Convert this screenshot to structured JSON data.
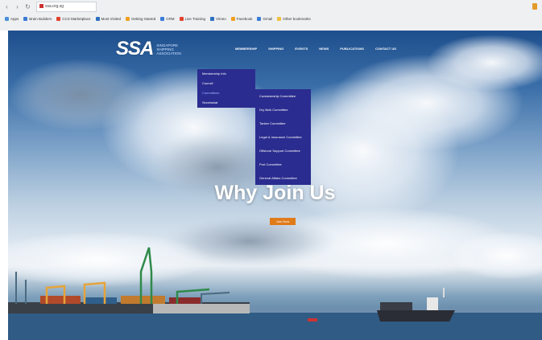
{
  "browser": {
    "url": "ssa.org.sg",
    "bookmarks": [
      {
        "label": "Apps",
        "color": "#4a90d9"
      },
      {
        "label": "Brain Builders",
        "color": "#3b7bd6"
      },
      {
        "label": "CCS Marketplace",
        "color": "#e0412b"
      },
      {
        "label": "Most Visited",
        "color": "#2d6fc0"
      },
      {
        "label": "Getting Started",
        "color": "#f0a020"
      },
      {
        "label": "CRM",
        "color": "#3b7bd6"
      },
      {
        "label": "Live Training",
        "color": "#e0412b"
      },
      {
        "label": "Vimeo",
        "color": "#2d6fc0"
      },
      {
        "label": "Facebook",
        "color": "#f0a020"
      },
      {
        "label": "Gmail",
        "color": "#3b7bd6"
      },
      {
        "label": "Other bookmarks",
        "color": "#f0c040"
      }
    ]
  },
  "site": {
    "logo_mark": "SSA",
    "logo_line1": "SINGAPORE",
    "logo_line2": "SHIPPING",
    "logo_line3": "ASSOCIATION"
  },
  "nav": {
    "items": [
      "MEMBERSHIP",
      "SHIPPING",
      "EVENTS",
      "NEWS",
      "PUBLICATIONS",
      "CONTACT US"
    ]
  },
  "menu_primary": {
    "items": [
      "Membership Info",
      "Council",
      "Committees",
      "Secretariat"
    ],
    "active_index": 2
  },
  "menu_secondary": {
    "items": [
      "Containership Committee",
      "Dry Bulk Committee",
      "Tanker Committee",
      "Legal & Insurance Committee",
      "Offshore Support Committee",
      "Port Committee",
      "General Affairs Committee"
    ]
  },
  "hero": {
    "title": "Why Join Us",
    "button": "Join Now"
  },
  "colors": {
    "menu_bg": "#2b2c8f",
    "accent": "#e07b1a"
  }
}
